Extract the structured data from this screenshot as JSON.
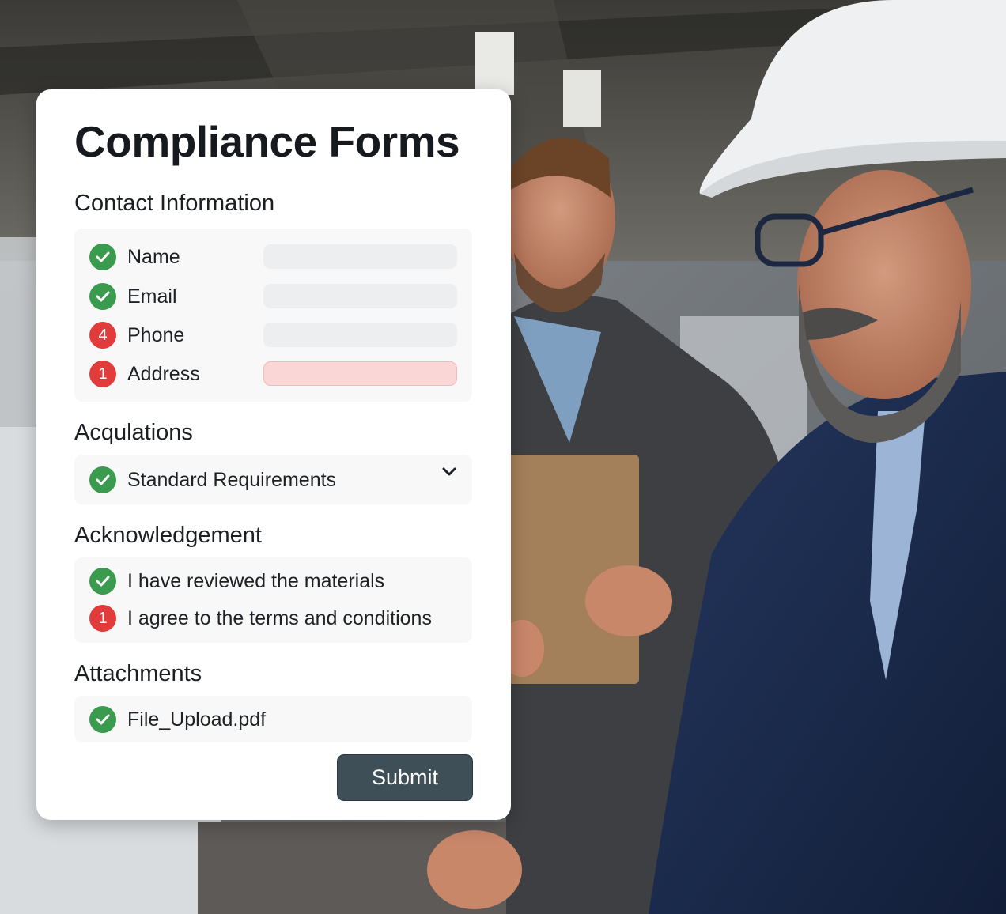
{
  "form": {
    "title": "Compliance Forms",
    "submit_label": "Submit"
  },
  "contact": {
    "heading": "Contact Information",
    "fields": [
      {
        "label": "Name",
        "status": "ok",
        "badge": ""
      },
      {
        "label": "Email",
        "status": "ok",
        "badge": ""
      },
      {
        "label": "Phone",
        "status": "error",
        "badge": "4"
      },
      {
        "label": "Address",
        "status": "error",
        "badge": "1"
      }
    ]
  },
  "acqulations": {
    "heading": "Acqulations",
    "selected": "Standard Requirements",
    "status": "ok"
  },
  "acknowledgement": {
    "heading": "Acknowledgement",
    "items": [
      {
        "label": "I have reviewed the materials",
        "status": "ok",
        "badge": ""
      },
      {
        "label": "I agree to the terms and conditions",
        "status": "error",
        "badge": "1"
      }
    ]
  },
  "attachments": {
    "heading": "Attachments",
    "file": "File_Upload.pdf",
    "status": "ok"
  },
  "colors": {
    "success": "#3a9a4d",
    "error": "#e23b3b",
    "error_field": "#fbd6d6",
    "submit_button": "#3f4f57"
  },
  "icons": {
    "ok": "check-circle-icon",
    "dropdown": "chevron-down-icon"
  }
}
